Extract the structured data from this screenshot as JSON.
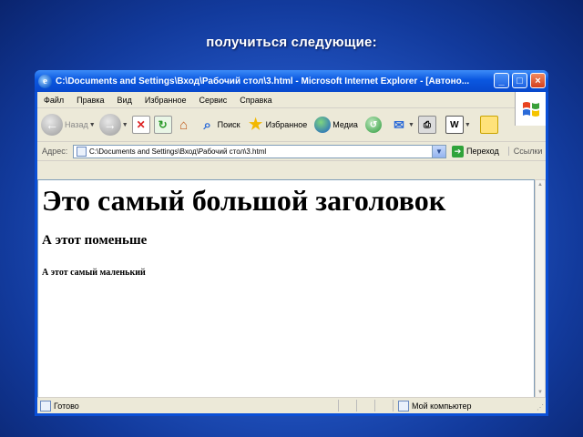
{
  "slide": {
    "caption": "получиться следующие:"
  },
  "window": {
    "title": "C:\\Documents and Settings\\Вход\\Рабочий стол\\3.html - Microsoft Internet Explorer - [Автоно..."
  },
  "menu": [
    "Файл",
    "Правка",
    "Вид",
    "Избранное",
    "Сервис",
    "Справка"
  ],
  "toolbar": {
    "back_label": "Назад",
    "search_label": "Поиск",
    "favorites_label": "Избранное",
    "media_label": "Медиа"
  },
  "address": {
    "label": "Адрес:",
    "value": "C:\\Documents and Settings\\Вход\\Рабочий стол\\3.html",
    "go_label": "Переход",
    "links_label": "Ссылки"
  },
  "page": {
    "h1": "Это самый большой заголовок",
    "h2": "А этот поменьше",
    "h3": "А этот самый маленький"
  },
  "status": {
    "text": "Готово",
    "zone": "Мой компьютер"
  }
}
